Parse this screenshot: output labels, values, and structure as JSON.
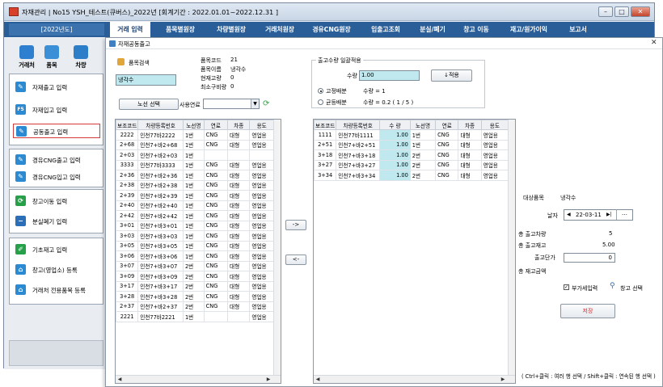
{
  "window": {
    "title": "자재관리 | No15 YSH_테스트(큐버스)_2022년 [회계기간 : 2022.01.01~2022.12.31 ]"
  },
  "menubar": {
    "year_label": "[2022년도]",
    "items": [
      "거래 입력",
      "품목별원장",
      "차량별원장",
      "거래처원장",
      "경유CNG원장",
      "입출고조회",
      "분실/폐기",
      "창고 이동",
      "재고/원가이익",
      "보고서"
    ]
  },
  "sidebar": {
    "top_buttons": [
      "거래처",
      "품목",
      "차량"
    ],
    "groups": [
      {
        "items": [
          {
            "label": "자재출고 입력",
            "icon": "pencil-icon"
          },
          {
            "label": "자재입고 입력",
            "icon": "f5-icon"
          },
          {
            "label": "공동출고 입력",
            "icon": "pencil-icon"
          }
        ]
      },
      {
        "items": [
          {
            "label": "경유CNG출고 입력",
            "icon": "pencil-icon"
          },
          {
            "label": "경유CNG입고 입력",
            "icon": "pencil-icon"
          }
        ]
      },
      {
        "items": [
          {
            "label": "창고이동 입력",
            "icon": "refresh-icon"
          },
          {
            "label": "분실폐기 입력",
            "icon": "minus-icon"
          }
        ]
      },
      {
        "items": [
          {
            "label": "기초재고 입력",
            "icon": "edit-icon"
          },
          {
            "label": "창고(영업소) 등록",
            "icon": "home-icon"
          },
          {
            "label": "거래처 전용품목 등록",
            "icon": "home-icon"
          }
        ]
      }
    ]
  },
  "dialog": {
    "title": "자재공동출고",
    "item_search_label": "품목검색",
    "item_search_value": "냉각수",
    "item_info": {
      "code_label": "품목코드",
      "code": "21",
      "name_label": "품목이름",
      "name": "냉각수",
      "stock_label": "현재고량",
      "stock": "0",
      "min_label": "최소구비량",
      "min": "0"
    },
    "route_button": "노선 선택",
    "usage_label": "사용연료",
    "usage_value": "",
    "bulk": {
      "legend": "출고수량 일괄적용",
      "qty_label": "수량",
      "qty_value": "1.00",
      "apply_button": "↓적용",
      "radio_fixed": "고정배분",
      "radio_equal": "균등배분",
      "fixed_text": "수량 = 1",
      "equal_text": "수량 = 0.2 ( 1 / 5 )"
    },
    "left_grid": {
      "headers": [
        "보조코드",
        "차량등록번호",
        "노선명",
        "연료",
        "차종",
        "용도"
      ],
      "rows": [
        [
          "2222",
          "인천77바2222",
          "1번",
          "CNG",
          "대형",
          "영업용"
        ],
        [
          "2+68",
          "인천7+바2+68",
          "1번",
          "CNG",
          "대형",
          "영업용"
        ],
        [
          "2+03",
          "인천7+바2+03",
          "1번",
          "",
          "",
          ""
        ],
        [
          "3333",
          "인천77바3333",
          "1번",
          "CNG",
          "대형",
          "영업용"
        ],
        [
          "2+36",
          "인천7+바2+36",
          "1번",
          "CNG",
          "대형",
          "영업용"
        ],
        [
          "2+38",
          "인천7+바2+38",
          "1번",
          "CNG",
          "대형",
          "영업용"
        ],
        [
          "2+39",
          "인천7+바2+39",
          "1번",
          "CNG",
          "대형",
          "영업용"
        ],
        [
          "2+40",
          "인천7+바2+40",
          "1번",
          "CNG",
          "대형",
          "영업용"
        ],
        [
          "2+42",
          "인천7+바2+42",
          "1번",
          "CNG",
          "대형",
          "영업용"
        ],
        [
          "3+01",
          "인천7+바3+01",
          "1번",
          "CNG",
          "대형",
          "영업용"
        ],
        [
          "3+03",
          "인천7+바3+03",
          "1번",
          "CNG",
          "대형",
          "영업용"
        ],
        [
          "3+05",
          "인천7+바3+05",
          "1번",
          "CNG",
          "대형",
          "영업용"
        ],
        [
          "3+06",
          "인천7+바3+06",
          "1번",
          "CNG",
          "대형",
          "영업용"
        ],
        [
          "3+07",
          "인천7+바3+07",
          "2번",
          "CNG",
          "대형",
          "영업용"
        ],
        [
          "3+09",
          "인천7+바3+09",
          "2번",
          "CNG",
          "대형",
          "영업용"
        ],
        [
          "3+17",
          "인천7+바3+17",
          "2번",
          "CNG",
          "대형",
          "영업용"
        ],
        [
          "3+28",
          "인천7+바3+28",
          "2번",
          "CNG",
          "대형",
          "영업용"
        ],
        [
          "2+37",
          "인천7+바2+37",
          "2번",
          "CNG",
          "대형",
          "영업용"
        ],
        [
          "2221",
          "인천77바2221",
          "1번",
          "",
          "",
          "영업용"
        ]
      ]
    },
    "move_right": "->",
    "move_left": "<-",
    "right_grid": {
      "headers": [
        "보조코드",
        "차량등록번호",
        "수 량",
        "노선명",
        "연료",
        "차종",
        "용도"
      ],
      "rows": [
        [
          "1111",
          "인천77바1111",
          "1.00",
          "1번",
          "CNG",
          "대형",
          "영업용"
        ],
        [
          "2+51",
          "인천7+바2+51",
          "1.00",
          "1번",
          "CNG",
          "대형",
          "영업용"
        ],
        [
          "3+18",
          "인천7+바3+18",
          "1.00",
          "2번",
          "CNG",
          "대형",
          "영업용"
        ],
        [
          "3+27",
          "인천7+바3+27",
          "1.00",
          "2번",
          "CNG",
          "대형",
          "영업용"
        ],
        [
          "3+34",
          "인천7+바3+34",
          "1.00",
          "2번",
          "CNG",
          "대형",
          "영업용"
        ]
      ]
    },
    "summary": {
      "target_label": "대상품목",
      "target_value": "냉각수",
      "date_label": "날자",
      "date_value": "22-03-11",
      "vehicles_label": "총 출고차량",
      "vehicles_value": "5",
      "total_qty_label": "총 출고재고",
      "total_qty_value": "5.00",
      "unit_price_label": "출고단가",
      "unit_price_value": "0",
      "total_amount_label": "총 재고금액",
      "total_amount_value": "",
      "vat_label": "부가세입력",
      "warehouse_label": "창고 선택",
      "save_button": "저장",
      "hint": "( Ctrl+클릭 : 여러 행 선택 / Shift+클릭 : 연속된 행 선택 )"
    }
  },
  "colors": {
    "menubar": "#2a5e98",
    "accent_cyan": "#bfe8ef",
    "save_text": "#d42a2a",
    "highlight_border": "#d43a3a"
  }
}
